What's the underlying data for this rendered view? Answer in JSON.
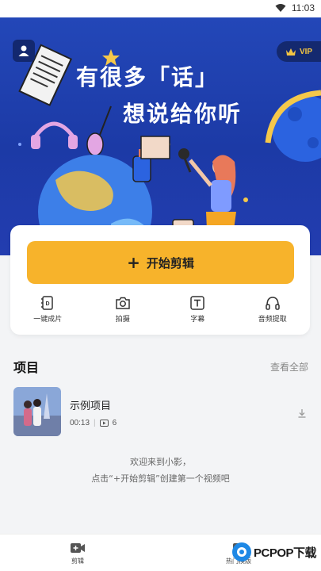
{
  "status_bar": {
    "time": "11:03"
  },
  "banner": {
    "vip_label": "VIP",
    "headline_line1": "有很多「话」",
    "headline_line2": "想说给你听"
  },
  "actions": {
    "start_edit_label": "开始剪辑",
    "tools": [
      {
        "label": "一键成片",
        "icon": "one-click-video-icon"
      },
      {
        "label": "拍摄",
        "icon": "camera-icon"
      },
      {
        "label": "字幕",
        "icon": "subtitle-icon"
      },
      {
        "label": "音频提取",
        "icon": "headphones-icon"
      }
    ]
  },
  "projects": {
    "title": "项目",
    "view_all": "查看全部",
    "items": [
      {
        "name": "示例项目",
        "duration": "00:13",
        "clips": "6"
      }
    ]
  },
  "welcome": {
    "line1": "欢迎来到小影，",
    "line2": "点击“+开始剪辑”创建第一个视频吧"
  },
  "nav": {
    "edit_label": "剪辑",
    "template_label": "热门模版"
  },
  "watermark": {
    "text": "PCPOP下载"
  },
  "colors": {
    "banner_blue": "#2347b8",
    "accent_yellow": "#f7b32b",
    "vip_gold": "#f4c542"
  }
}
